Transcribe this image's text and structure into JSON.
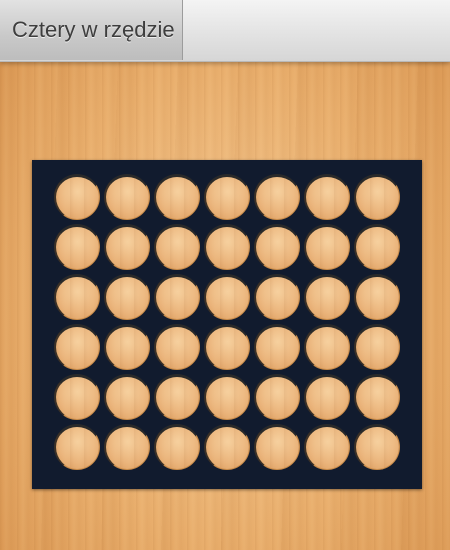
{
  "header": {
    "title": "Cztery w rzędzie"
  },
  "board": {
    "columns": 7,
    "rows": 6,
    "board_color": "#111b2e",
    "cells": [
      [
        "",
        "",
        "",
        "",
        "",
        "",
        ""
      ],
      [
        "",
        "",
        "",
        "",
        "",
        "",
        ""
      ],
      [
        "",
        "",
        "",
        "",
        "",
        "",
        ""
      ],
      [
        "",
        "",
        "",
        "",
        "",
        "",
        ""
      ],
      [
        "",
        "",
        "",
        "",
        "",
        "",
        ""
      ],
      [
        "",
        "",
        "",
        "",
        "",
        "",
        ""
      ]
    ]
  }
}
